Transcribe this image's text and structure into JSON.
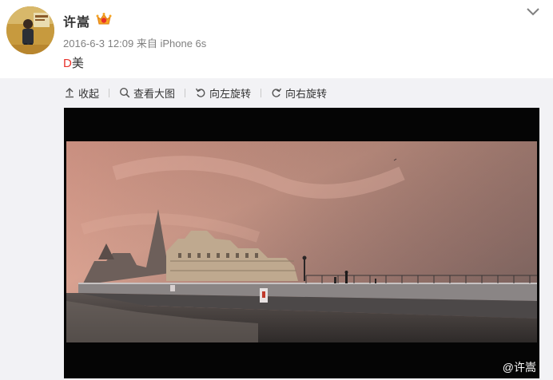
{
  "post": {
    "username": "许嵩",
    "timestamp": "2016-6-3 12:09",
    "source_prefix": "来自",
    "source_device": "iPhone 6s",
    "content_letter": "D",
    "content_rest": "美"
  },
  "header_icons": {
    "badge": "crown-badge-icon",
    "menu": "chevron-down-icon"
  },
  "toolbar": {
    "collapse": "收起",
    "view_large": "查看大图",
    "rotate_left": "向左旋转",
    "rotate_right": "向右旋转"
  },
  "photo": {
    "watermark": "@许嵩"
  },
  "colors": {
    "accent_red": "#e8322b",
    "panel_bg": "#f2f2f5",
    "meta_gray": "#808080"
  }
}
